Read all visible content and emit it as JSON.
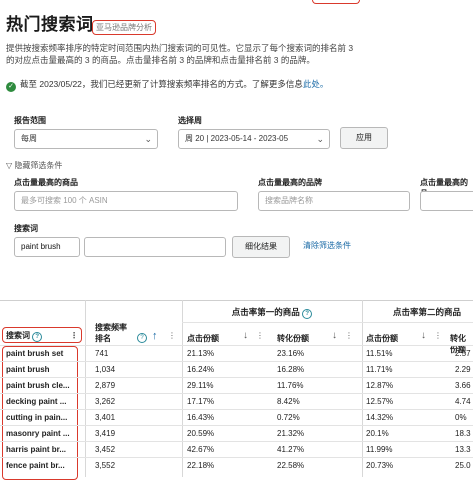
{
  "header": {
    "title": "热门搜索词",
    "title_link": "亚马逊品牌分析",
    "description_line1": "提供按搜索频率排序的特定时间范围内热门搜索词的可见性。它显示了每个搜索词的排名前 3",
    "description_line2": "的对应点击量最高的 3 的商品。点击量排名前 3 的品牌和点击量排名前 3 的品牌。",
    "notice": "截至 2023/05/22，我们已经更新了计算搜索频率排名的方式。了解更多信息",
    "notice_link": "此处。"
  },
  "filters": {
    "report_range_label": "报告范围",
    "report_range_value": "每周",
    "week_label": "选择周",
    "week_value": "周 20 | 2023-05-14 - 2023-05",
    "apply_button": "应用",
    "advanced_toggle": "隐藏筛选条件",
    "top_product_label": "点击量最高的商品",
    "top_product_placeholder": "最多可搜索 100 个 ASIN",
    "top_brand_label": "点击量最高的品牌",
    "top_brand_placeholder": "搜索品牌名称",
    "top_category_label": "点击量最高的品",
    "search_term_label": "搜索词",
    "search_term_value": "paint brush",
    "refine_button": "细化结果",
    "clear_link": "清除筛选条件"
  },
  "table": {
    "group1": "点击率第一的商品",
    "group2": "点击率第二的商品",
    "col_term": "搜索词",
    "col_rank_line1": "搜索频率",
    "col_rank_line2": "排名",
    "col_click_share": "点击份额",
    "col_conv_share": "转化份额",
    "col_click_share2": "点击份额",
    "col_conv_share2": "转化份额",
    "rows": [
      {
        "term": "paint brush set",
        "rank": "741",
        "click1": "21.13%",
        "conv1": "23.16%",
        "click2": "11.51%",
        "conv2": "2.57"
      },
      {
        "term": "paint brush",
        "rank": "1,034",
        "click1": "16.24%",
        "conv1": "16.28%",
        "click2": "11.71%",
        "conv2": "2.29"
      },
      {
        "term": "paint brush cle...",
        "rank": "2,879",
        "click1": "29.11%",
        "conv1": "11.76%",
        "click2": "12.87%",
        "conv2": "3.66"
      },
      {
        "term": "decking paint ...",
        "rank": "3,262",
        "click1": "17.17%",
        "conv1": "8.42%",
        "click2": "12.57%",
        "conv2": "4.74"
      },
      {
        "term": "cutting in pain...",
        "rank": "3,401",
        "click1": "16.43%",
        "conv1": "0.72%",
        "click2": "14.32%",
        "conv2": "0%"
      },
      {
        "term": "masonry paint ...",
        "rank": "3,419",
        "click1": "20.59%",
        "conv1": "21.32%",
        "click2": "20.1%",
        "conv2": "18.3"
      },
      {
        "term": "harris paint br...",
        "rank": "3,452",
        "click1": "42.67%",
        "conv1": "41.27%",
        "click2": "11.99%",
        "conv2": "13.3"
      },
      {
        "term": "fence paint br...",
        "rank": "3,552",
        "click1": "22.18%",
        "conv1": "22.58%",
        "click2": "20.73%",
        "conv2": "25.0"
      }
    ]
  }
}
